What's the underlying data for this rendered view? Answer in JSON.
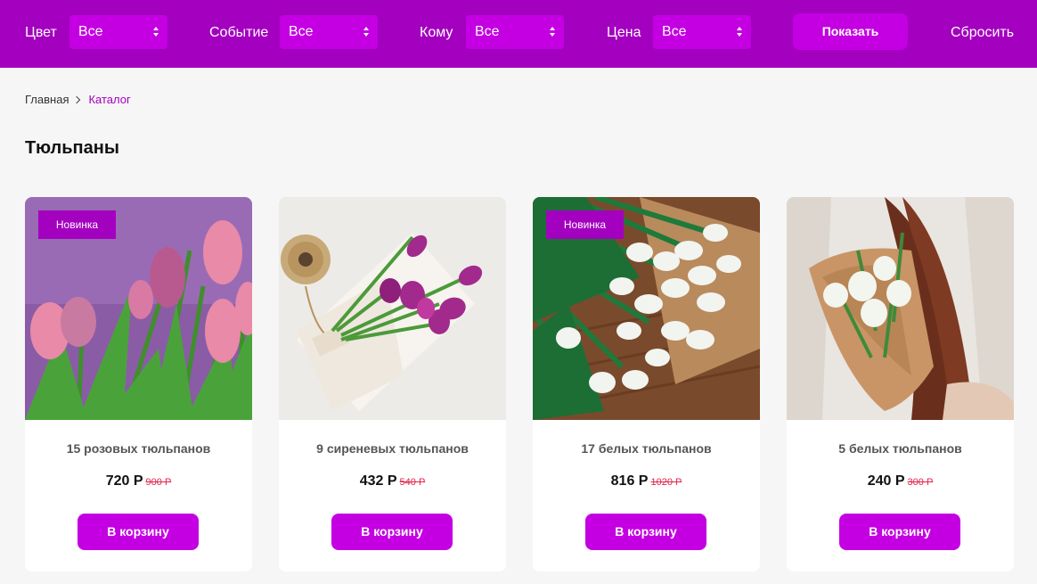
{
  "filters": [
    {
      "label": "Цвет",
      "value": "Все"
    },
    {
      "label": "Событие",
      "value": "Все"
    },
    {
      "label": "Кому",
      "value": "Все"
    },
    {
      "label": "Цена",
      "value": "Все"
    }
  ],
  "show_label": "Показать",
  "reset_label": "Сбросить",
  "breadcrumb": {
    "home": "Главная",
    "current": "Каталог"
  },
  "page_title": "Тюльпаны",
  "products": [
    {
      "name": "15 розовых тюльпанов",
      "price": "720 Р",
      "old_price": "900 Р",
      "badge": "Новинка",
      "cart_label": "В корзину"
    },
    {
      "name": "9 сиреневых тюльпанов",
      "price": "432 Р",
      "old_price": "540 Р",
      "badge": "",
      "cart_label": "В корзину"
    },
    {
      "name": "17 белых тюльпанов",
      "price": "816 Р",
      "old_price": "1020 Р",
      "badge": "Новинка",
      "cart_label": "В корзину"
    },
    {
      "name": "5 белых тюльпанов",
      "price": "240 Р",
      "old_price": "300 Р",
      "badge": "",
      "cart_label": "В корзину"
    }
  ],
  "colors": {
    "brand_dark": "#a300bf",
    "brand": "#c400e3",
    "old_price": "#e0254b"
  }
}
